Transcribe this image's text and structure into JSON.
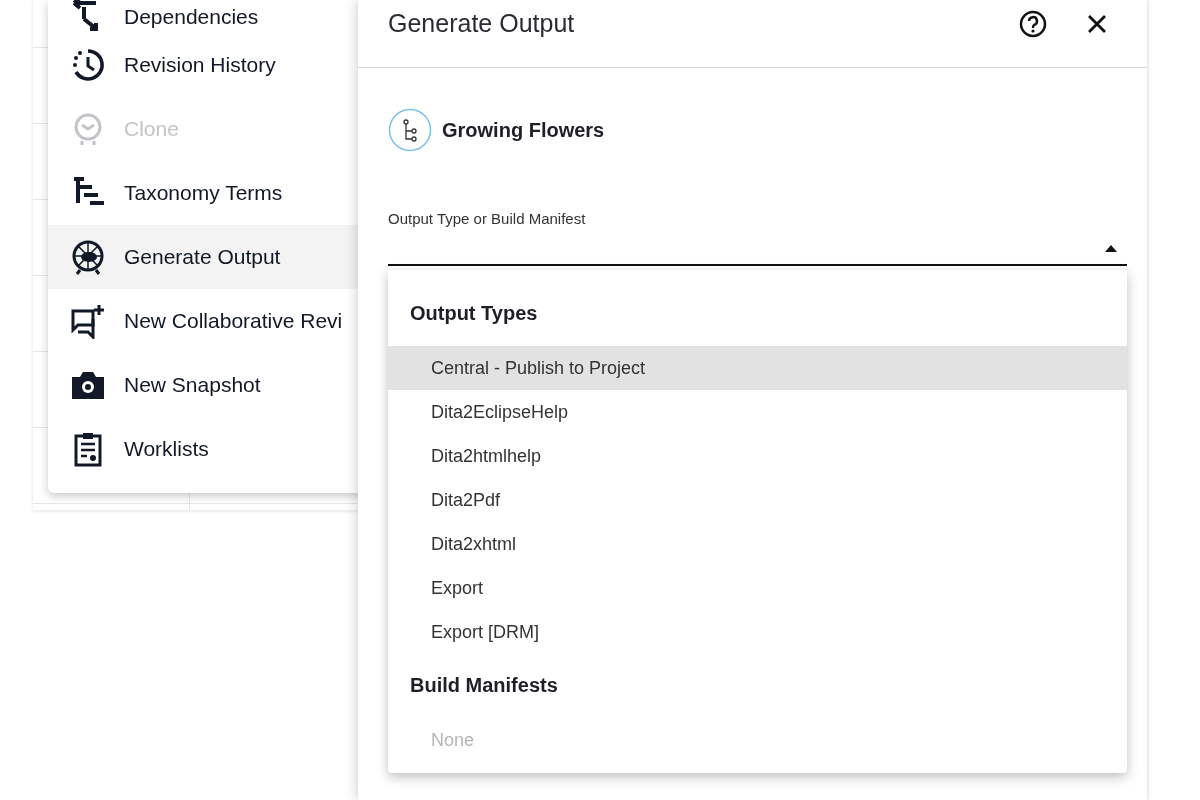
{
  "menu": {
    "items": [
      {
        "label": "Dependencies",
        "kind": "dependencies",
        "disabled": false,
        "selected": false
      },
      {
        "label": "Revision History",
        "kind": "history",
        "disabled": false,
        "selected": false
      },
      {
        "label": "Clone",
        "kind": "clone",
        "disabled": true,
        "selected": false
      },
      {
        "label": "Taxonomy Terms",
        "kind": "taxonomy",
        "disabled": false,
        "selected": false
      },
      {
        "label": "Generate Output",
        "kind": "generate",
        "disabled": false,
        "selected": true
      },
      {
        "label": "New Collaborative Revi",
        "kind": "review",
        "disabled": false,
        "selected": false
      },
      {
        "label": "New Snapshot",
        "kind": "snapshot",
        "disabled": false,
        "selected": false
      },
      {
        "label": "Worklists",
        "kind": "worklists",
        "disabled": false,
        "selected": false
      }
    ]
  },
  "dialog": {
    "title": "Generate Output",
    "item_name": "Growing Flowers",
    "field": {
      "label": "Output Type or Build Manifest",
      "expanded": true
    },
    "dropdown": {
      "groups": [
        {
          "heading": "Output Types",
          "options": [
            {
              "label": "Central - Publish to Project",
              "selected": true,
              "disabled": false
            },
            {
              "label": "Dita2EclipseHelp",
              "selected": false,
              "disabled": false
            },
            {
              "label": "Dita2htmlhelp",
              "selected": false,
              "disabled": false
            },
            {
              "label": "Dita2Pdf",
              "selected": false,
              "disabled": false
            },
            {
              "label": "Dita2xhtml",
              "selected": false,
              "disabled": false
            },
            {
              "label": "Export",
              "selected": false,
              "disabled": false
            },
            {
              "label": "Export [DRM]",
              "selected": false,
              "disabled": false
            }
          ]
        },
        {
          "heading": "Build Manifests",
          "options": [
            {
              "label": "None",
              "selected": false,
              "disabled": true
            }
          ]
        }
      ]
    }
  }
}
